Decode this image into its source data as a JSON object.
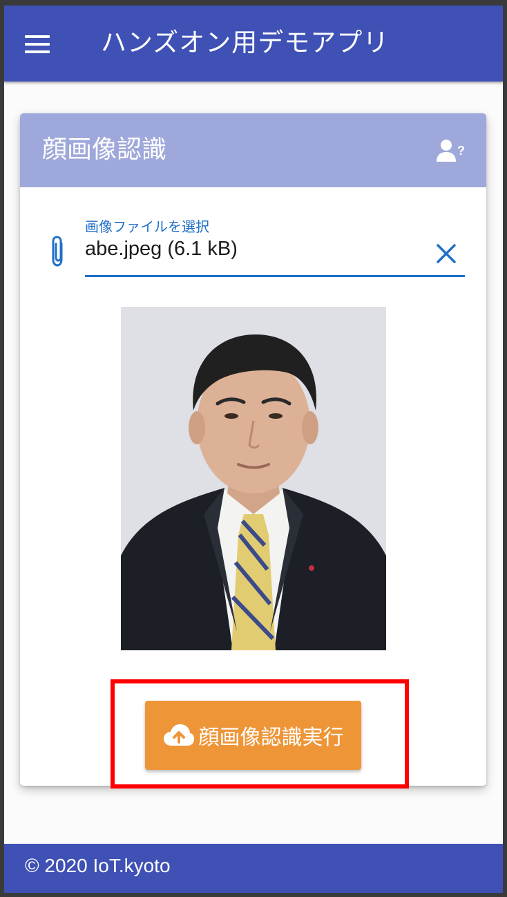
{
  "app_bar": {
    "menu_icon": "menu-icon",
    "title": "ハンズオン用デモアプリ",
    "color": "#3f51b5"
  },
  "card": {
    "title": "顔画像認識",
    "header_icon": "face-help-icon",
    "header_color": "#9fa8da",
    "file_input": {
      "icon": "paperclip-icon",
      "label": "画像ファイルを選択",
      "value": "abe.jpeg (6.1 kB)",
      "clear_icon": "close-icon",
      "accent": "#1f6fc8"
    },
    "preview_image": "portrait-photo",
    "run_button": {
      "icon": "cloud-upload-icon",
      "label": "顔画像認識実行",
      "color": "#ee9537"
    }
  },
  "annotation": {
    "highlight_color": "#ff0000"
  },
  "footer": {
    "text": "© 2020 IoT.kyoto"
  }
}
